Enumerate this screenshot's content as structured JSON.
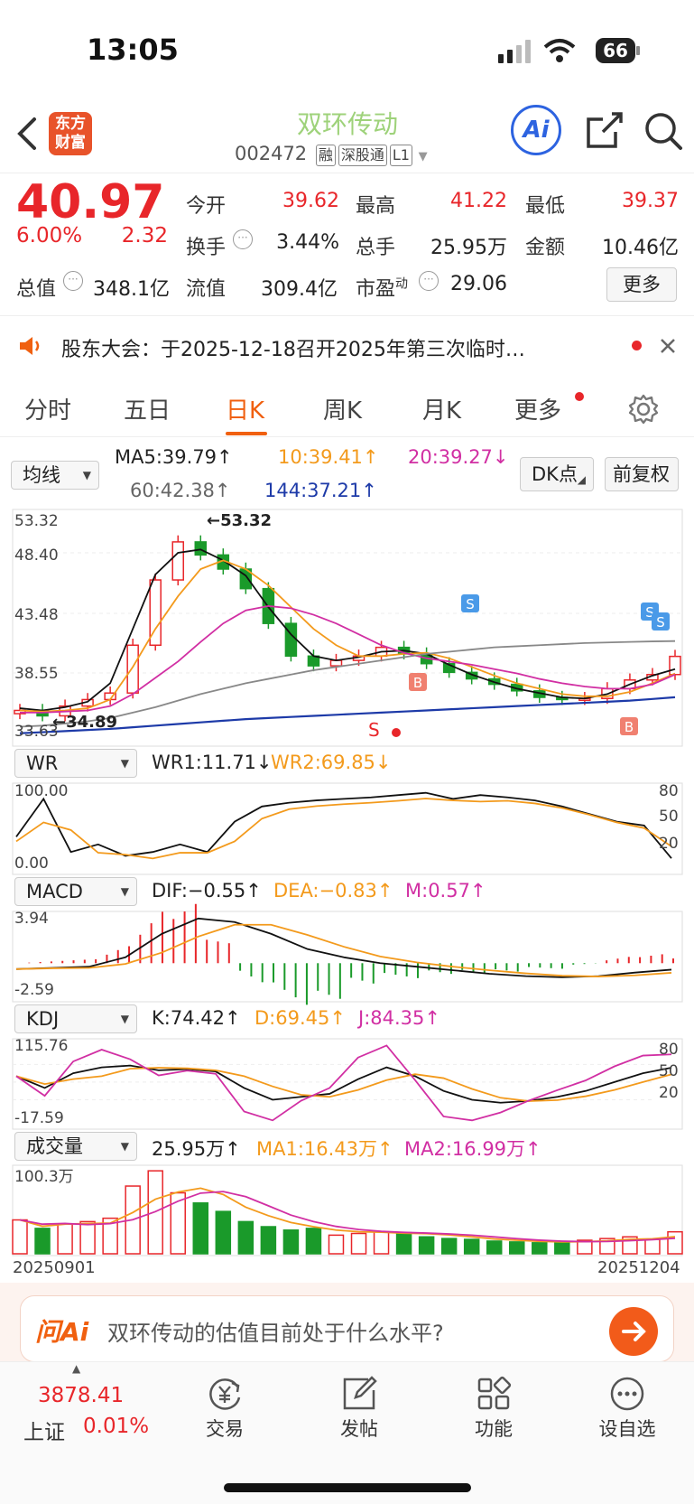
{
  "status_bar": {
    "time": "13:05",
    "battery": "66"
  },
  "header": {
    "logo_text": "东方财富",
    "title": "双环传动",
    "code": "002472",
    "tags": [
      "融",
      "深股通",
      "L1"
    ],
    "ai_label": "Ai"
  },
  "quote": {
    "price": "40.97",
    "change_pct": "6.00%",
    "change": "2.32",
    "rows": [
      [
        {
          "label": "今开",
          "value": "39.62",
          "color": "#e8262a"
        },
        {
          "label": "最高",
          "value": "41.22",
          "color": "#e8262a"
        },
        {
          "label": "最低",
          "value": "39.37",
          "color": "#e8262a"
        }
      ],
      [
        {
          "label": "换手",
          "value": "3.44%",
          "color": "#222222"
        },
        {
          "label": "总手",
          "value": "25.95万",
          "color": "#222222"
        },
        {
          "label": "金额",
          "value": "10.46亿",
          "color": "#222222"
        }
      ],
      [
        {
          "label": "总值",
          "value": "348.1亿",
          "color": "#222222"
        },
        {
          "label": "流值",
          "value": "309.4亿",
          "color": "#222222"
        },
        {
          "label": "市盈",
          "value": "29.06",
          "color": "#222222"
        }
      ]
    ],
    "pe_sup": "动",
    "more_button": "更多"
  },
  "notice": {
    "text": "股东大会：于2025-12-18召开2025年第三次临时…"
  },
  "tabs": {
    "items": [
      "分时",
      "五日",
      "日K",
      "周K",
      "月K",
      "更多"
    ],
    "active": 2
  },
  "ma_panel": {
    "selector": "均线",
    "ma5": "MA5:39.79↑",
    "ma10": "10:39.41↑",
    "ma20": "20:39.27↓",
    "ma60": "60:42.38↑",
    "ma144": "144:37.21↑",
    "dk_button": "DK点",
    "adjust_button": "前复权"
  },
  "price_axis": {
    "labels": [
      "53.32",
      "48.40",
      "43.48",
      "38.55",
      "33.63"
    ],
    "high_marker": "53.32",
    "low_marker": "34.89",
    "signal_s": "S",
    "signal_b": "B"
  },
  "wr_panel": {
    "selector": "WR",
    "wr1": "WR1:11.71↓",
    "wr2": "WR2:69.85↓",
    "axis": [
      "100.00",
      "0.00"
    ],
    "right_axis": [
      "80",
      "50",
      "20"
    ]
  },
  "macd_panel": {
    "selector": "MACD",
    "dif": "DIF:−0.55↑",
    "dea": "DEA:−0.83↑",
    "m": "M:0.57↑",
    "axis": [
      "3.94",
      "-2.59"
    ]
  },
  "kdj_panel": {
    "selector": "KDJ",
    "k": "K:74.42↑",
    "d": "D:69.45↑",
    "j": "J:84.35↑",
    "axis": [
      "115.76",
      "-17.59"
    ],
    "right_axis": [
      "80",
      "50",
      "20"
    ]
  },
  "vol_panel": {
    "selector": "成交量",
    "vol": "25.95万↑",
    "ma1": "MA1:16.43万↑",
    "ma2": "MA2:16.99万↑",
    "axis_top": "100.3万",
    "date_start": "20250901",
    "date_end": "20251204"
  },
  "ask_bar": {
    "logo": "问Ai",
    "prompt": "双环传动的估值目前处于什么水平?"
  },
  "bottom_nav": {
    "index_value": "3878.41",
    "index_name": "上证",
    "index_change": "0.01%",
    "items": [
      "交易",
      "发帖",
      "功能",
      "设自选"
    ]
  },
  "colors": {
    "up": "#e8262a",
    "down": "#1a9a2a",
    "ma5": "#111111",
    "ma10": "#f39a1c",
    "ma20": "#d12fa3",
    "ma60": "#888888",
    "ma144": "#1d3aa8",
    "accent": "#f06010"
  },
  "chart_data": {
    "type": "line",
    "title": "",
    "xlabel": "",
    "ylabel": "",
    "x_range": [
      "20250901",
      "20251204"
    ],
    "ylim": [
      33.63,
      53.32
    ],
    "series": [
      {
        "name": "MA5",
        "values": [
          36.2,
          36.0,
          36.3,
          36.8,
          38.5,
          43.5,
          48.5,
          50.5,
          50.8,
          49.8,
          48.4,
          45.5,
          43.0,
          41.0,
          40.6,
          40.9,
          41.4,
          41.5,
          41.2,
          40.2,
          39.3,
          38.6,
          38.0,
          37.6,
          37.2,
          37.1,
          37.5,
          38.4,
          39.2,
          39.8
        ]
      },
      {
        "name": "10",
        "values": [
          36.0,
          35.9,
          36.0,
          36.2,
          37.0,
          40.0,
          43.5,
          46.5,
          49.0,
          49.8,
          49.0,
          47.5,
          45.5,
          43.5,
          42.0,
          41.0,
          41.0,
          41.2,
          41.3,
          40.8,
          40.0,
          39.2,
          38.5,
          38.0,
          37.5,
          37.3,
          37.3,
          37.7,
          38.5,
          39.4
        ]
      },
      {
        "name": "20",
        "values": [
          35.8,
          35.8,
          35.9,
          36.0,
          36.4,
          37.5,
          39.0,
          40.5,
          42.3,
          44.0,
          45.2,
          45.6,
          45.4,
          44.8,
          44.0,
          43.0,
          42.0,
          41.3,
          40.8,
          40.5,
          40.2,
          39.8,
          39.4,
          38.9,
          38.5,
          38.2,
          38.0,
          38.0,
          38.4,
          39.3
        ]
      },
      {
        "name": "60",
        "values": [
          34.5,
          34.6,
          34.8,
          35.0,
          35.3,
          35.8,
          36.3,
          36.9,
          37.5,
          38.0,
          38.5,
          38.9,
          39.3,
          39.7,
          40.0,
          40.3,
          40.6,
          40.9,
          41.2,
          41.4,
          41.6,
          41.8,
          41.9,
          42.0,
          42.1,
          42.2,
          42.25,
          42.3,
          42.35,
          42.38
        ]
      },
      {
        "name": "144",
        "values": [
          33.9,
          34.0,
          34.1,
          34.2,
          34.3,
          34.45,
          34.6,
          34.75,
          34.9,
          35.05,
          35.2,
          35.3,
          35.4,
          35.5,
          35.6,
          35.7,
          35.8,
          35.9,
          36.0,
          36.1,
          36.2,
          36.3,
          36.4,
          36.5,
          36.6,
          36.7,
          36.8,
          36.9,
          37.05,
          37.21
        ]
      }
    ],
    "candles_close": [
      36.0,
      35.5,
      36.4,
      37.0,
      37.6,
      42.0,
      48.0,
      51.5,
      50.3,
      49.0,
      47.2,
      44.0,
      41.0,
      40.1,
      40.6,
      41.0,
      41.8,
      41.2,
      40.3,
      39.5,
      38.9,
      38.4,
      37.8,
      37.2,
      37.0,
      37.1,
      38.0,
      38.8,
      39.3,
      40.97
    ],
    "volume": [
      40,
      30,
      35,
      38,
      42,
      80,
      98,
      72,
      60,
      50,
      38,
      32,
      28,
      30,
      22,
      24,
      26,
      25,
      20,
      18,
      17,
      15,
      14,
      13,
      14,
      16,
      18,
      20,
      17,
      25.95
    ],
    "wr1": [
      40,
      90,
      20,
      30,
      15,
      20,
      30,
      20,
      60,
      80,
      85,
      88,
      90,
      92,
      95,
      98,
      90,
      95,
      92,
      88,
      80,
      70,
      60,
      55,
      11.71
    ],
    "macd_dif": [
      -0.5,
      -0.4,
      -0.3,
      0.5,
      2.5,
      3.8,
      3.5,
      2.5,
      1.2,
      0.5,
      0.0,
      -0.3,
      -0.6,
      -0.9,
      -1.1,
      -1.2,
      -1.1,
      -0.8,
      -0.55
    ],
    "kdj_k": [
      60,
      40,
      65,
      75,
      78,
      70,
      72,
      68,
      40,
      20,
      25,
      30,
      55,
      75,
      60,
      35,
      20,
      15,
      18,
      25,
      35,
      50,
      65,
      74.42
    ]
  }
}
